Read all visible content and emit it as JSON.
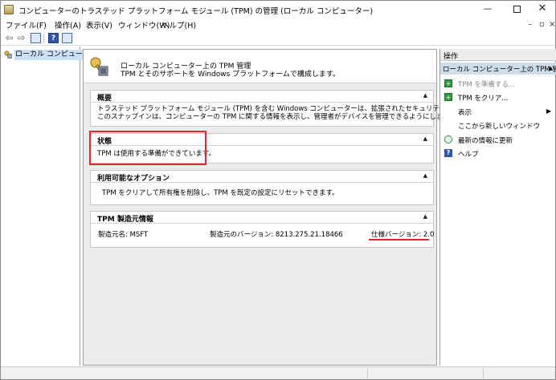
{
  "window": {
    "title": "コンピューターのトラステッド プラットフォーム モジュール (TPM) の管理 (ローカル コンピューター)",
    "min_glyph": "—",
    "close_glyph": "✕",
    "mdi_min_glyph": "–",
    "mdi_max_glyph": "▫",
    "mdi_close_glyph": "×"
  },
  "menu": {
    "file": "ファイル(F)",
    "action": "操作(A)",
    "view": "表示(V)",
    "window": "ウィンドウ(W)",
    "help": "ヘルプ(H)"
  },
  "toolbar": {
    "back_glyph": "⇦",
    "forward_glyph": "⇨",
    "help_glyph": "?"
  },
  "tree": {
    "root_label": "ローカル コンピューター上"
  },
  "header": {
    "title": "ローカル コンピューター上の TPM 管理",
    "subtitle": "TPM とそのサポートを Windows プラットフォームで構成します。"
  },
  "sections": {
    "overview": {
      "title": "概要",
      "line1": "トラステッド プラットフォーム モジュール (TPM) を含む Windows コンピューターは、拡張されたセキュリティ機能を提供します。",
      "line2": "このスナップインは、コンピューターの TPM に関する情報を表示し、管理者がデバイスを管理できるようにします。"
    },
    "status": {
      "title": "状態",
      "text": "TPM は使用する準備ができています。"
    },
    "options": {
      "title": "利用可能なオプション",
      "text": "TPM をクリアして所有権を削除し、TPM を既定の設定にリセットできます。"
    },
    "manufacturer": {
      "title": "TPM 製造元情報",
      "name": "製造元名: MSFT",
      "version": "製造元のバージョン: 8213.275.21.18466",
      "spec": "仕様バージョン: 2.0"
    },
    "collapse_glyph": "▲"
  },
  "actions": {
    "header": "操作",
    "subheader": "ローカル コンピューター上の TPM 管理",
    "items": [
      {
        "label": "TPM を準備する...",
        "enabled": false,
        "icon": "tpm-prepare-icon"
      },
      {
        "label": "TPM をクリア...",
        "enabled": true,
        "icon": "tpm-clear-icon"
      },
      {
        "label": "表示",
        "enabled": true,
        "icon": "none"
      },
      {
        "label": "ここから新しいウィンドウ",
        "enabled": true,
        "icon": "none"
      },
      {
        "label": "最新の情報に更新",
        "enabled": true,
        "icon": "refresh-icon"
      },
      {
        "label": "ヘルプ",
        "enabled": true,
        "icon": "help-icon"
      }
    ],
    "submenu_glyph": "▶",
    "collapse_glyph": "▲"
  },
  "colors": {
    "highlight_red": "#e0262b",
    "selection_blue": "#cce0f5",
    "action_header_blue": "#cfdde9"
  }
}
